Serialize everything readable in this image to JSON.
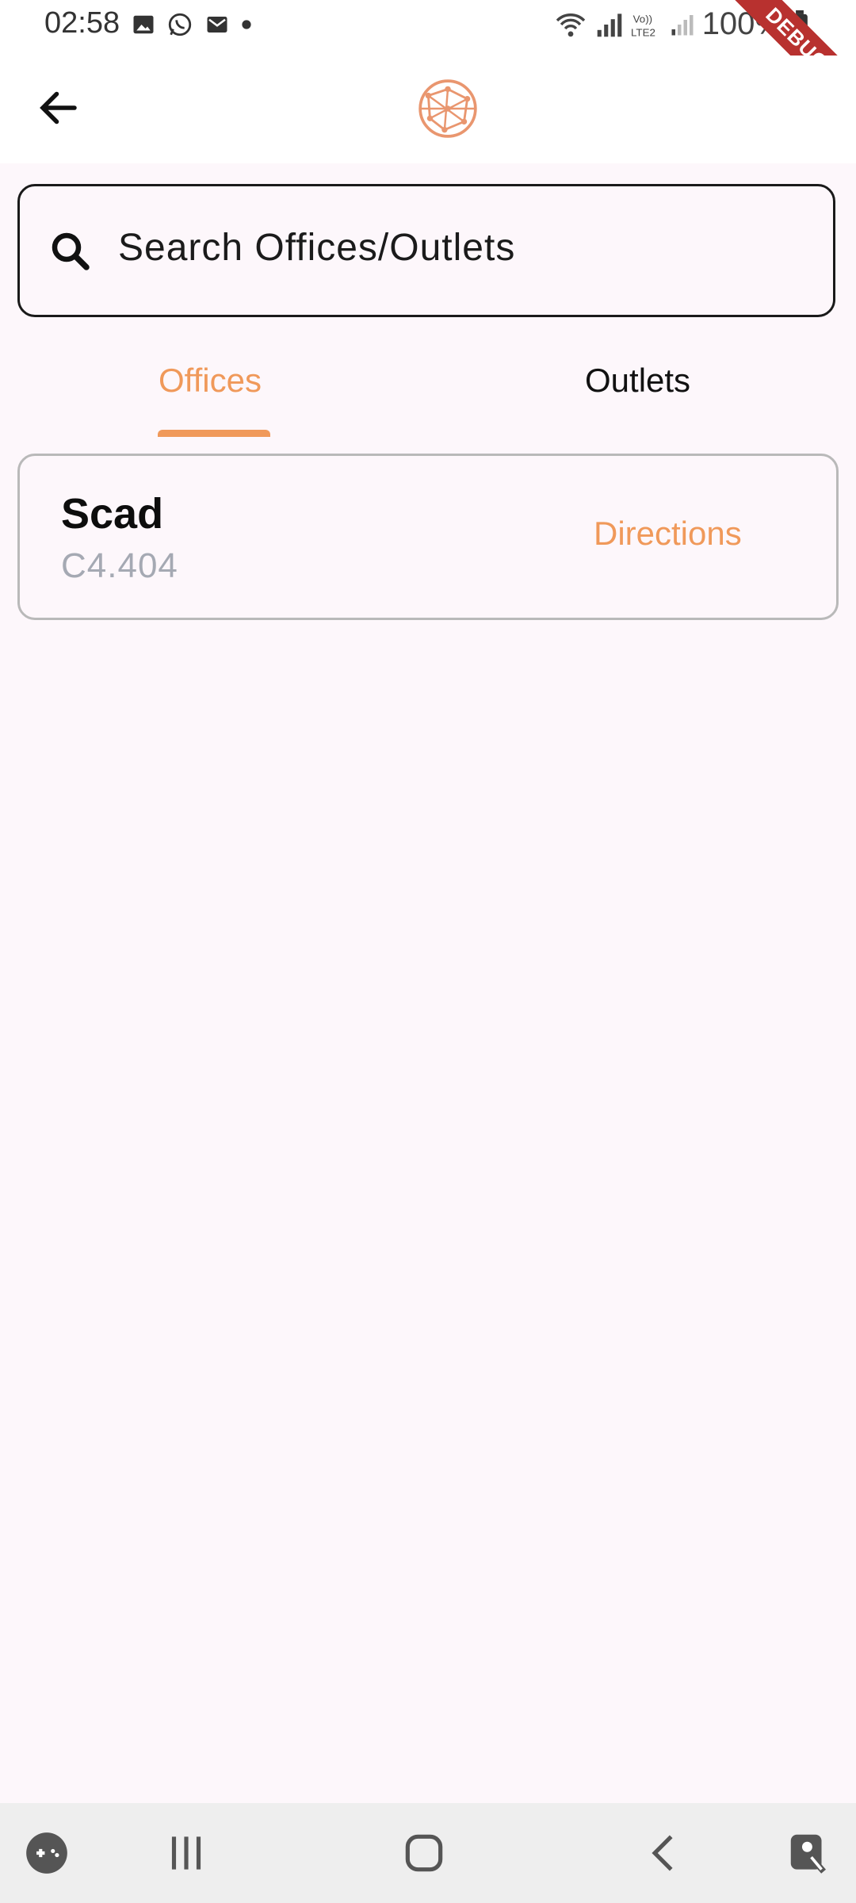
{
  "status_bar": {
    "time": "02:58",
    "battery": "100%",
    "notification_icons": [
      "image-icon",
      "whatsapp-icon",
      "mail-icon",
      "dot-icon"
    ],
    "system_icons": [
      "wifi-icon",
      "signal-icon",
      "volte-icon",
      "signal-icon-2",
      "battery-icon"
    ]
  },
  "debug_ribbon": "DEBUG",
  "app_bar": {
    "back_icon": "arrow-left-icon",
    "logo_icon": "globe-network-icon"
  },
  "search": {
    "placeholder": "Search Offices/Outlets",
    "icon": "search-icon"
  },
  "tabs": [
    {
      "label": "Offices",
      "selected": true
    },
    {
      "label": "Outlets",
      "selected": false
    }
  ],
  "offices": [
    {
      "name": "Scad",
      "code": "C4.404",
      "action": "Directions"
    }
  ],
  "nav_bar": {
    "items": [
      "game-launcher-icon",
      "recents-icon",
      "home-icon",
      "back-icon",
      "assistant-icon"
    ]
  },
  "colors": {
    "accent": "#f0995a",
    "background": "#fdf7fb",
    "card_border": "#b9b9b9",
    "muted_text": "#a5a9b3",
    "debug": "#b8312f"
  }
}
